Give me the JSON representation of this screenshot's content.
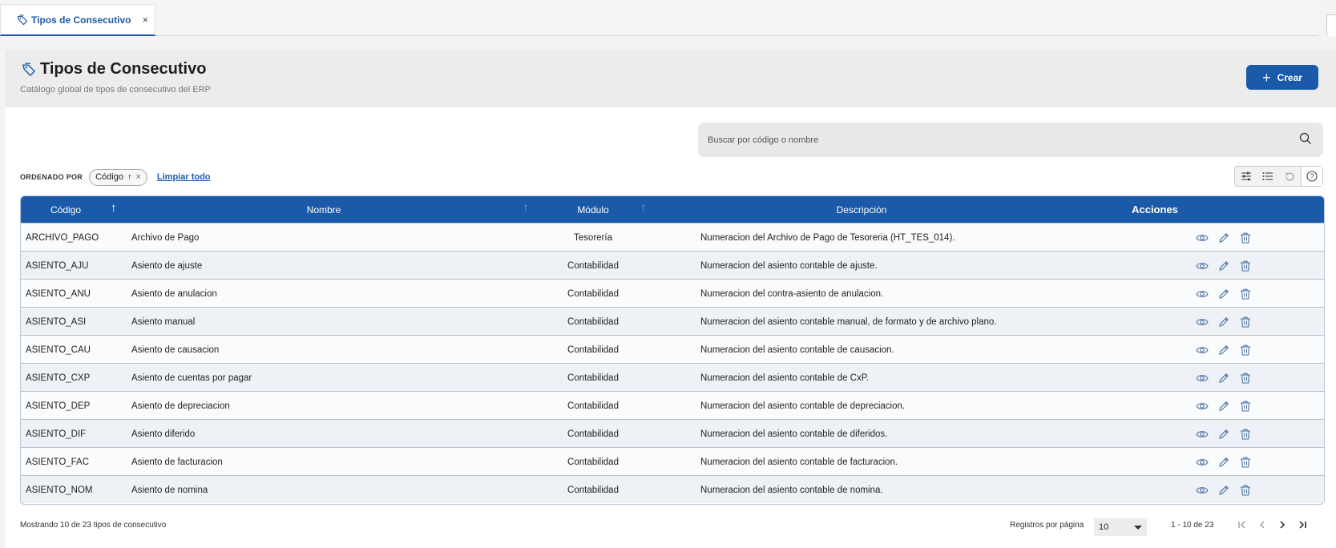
{
  "tab": {
    "label": "Tipos de Consecutivo"
  },
  "header": {
    "title": "Tipos de Consecutivo",
    "subtitle": "Catálogo global de tipos de consecutivo del ERP",
    "create_label": "Crear"
  },
  "search": {
    "placeholder": "Buscar por código o nombre"
  },
  "sort": {
    "label": "ORDENADO POR",
    "chip": "Código",
    "clear_label": "Limpiar todo"
  },
  "table": {
    "columns": {
      "code": "Código",
      "name": "Nombre",
      "module": "Módulo",
      "description": "Descripción",
      "actions": "Acciones"
    },
    "rows": [
      {
        "code": "ARCHIVO_PAGO",
        "name": "Archivo de Pago",
        "module": "Tesorería",
        "description": "Numeracion del Archivo de Pago de Tesoreria (HT_TES_014)."
      },
      {
        "code": "ASIENTO_AJU",
        "name": "Asiento de ajuste",
        "module": "Contabilidad",
        "description": "Numeracion del asiento contable de ajuste."
      },
      {
        "code": "ASIENTO_ANU",
        "name": "Asiento de anulacion",
        "module": "Contabilidad",
        "description": "Numeracion del contra-asiento de anulacion."
      },
      {
        "code": "ASIENTO_ASI",
        "name": "Asiento manual",
        "module": "Contabilidad",
        "description": "Numeracion del asiento contable manual, de formato y de archivo plano."
      },
      {
        "code": "ASIENTO_CAU",
        "name": "Asiento de causacion",
        "module": "Contabilidad",
        "description": "Numeracion del asiento contable de causacion."
      },
      {
        "code": "ASIENTO_CXP",
        "name": "Asiento de cuentas por pagar",
        "module": "Contabilidad",
        "description": "Numeracion del asiento contable de CxP."
      },
      {
        "code": "ASIENTO_DEP",
        "name": "Asiento de depreciacion",
        "module": "Contabilidad",
        "description": "Numeracion del asiento contable de depreciacion."
      },
      {
        "code": "ASIENTO_DIF",
        "name": "Asiento diferido",
        "module": "Contabilidad",
        "description": "Numeracion del asiento contable de diferidos."
      },
      {
        "code": "ASIENTO_FAC",
        "name": "Asiento de facturacion",
        "module": "Contabilidad",
        "description": "Numeracion del asiento contable de facturacion."
      },
      {
        "code": "ASIENTO_NOM",
        "name": "Asiento de nomina",
        "module": "Contabilidad",
        "description": "Numeracion del asiento contable de nomina."
      }
    ]
  },
  "footer": {
    "showing": "Mostrando 10 de 23 tipos de consecutivo",
    "per_page_label": "Registros por página",
    "per_page_value": "10",
    "range": "1 - 10 de 23"
  },
  "colors": {
    "primary": "#1b5aa8",
    "row_alt": "#eef2f6"
  }
}
